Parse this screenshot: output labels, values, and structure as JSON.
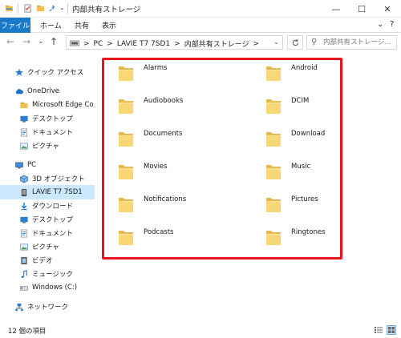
{
  "window": {
    "title": "内部共有ストレージ",
    "minimize": "—",
    "maximize": "☐",
    "close": "✕"
  },
  "ribbon": {
    "tabs": [
      "ファイル",
      "ホーム",
      "共有",
      "表示"
    ],
    "collapse": "⌄",
    "help": "?"
  },
  "nav": {
    "back": "←",
    "forward": "→",
    "recent": "⌄",
    "up": "↑"
  },
  "address": {
    "segments": [
      "PC",
      "LAVIE T7 7SD1",
      "内部共有ストレージ"
    ],
    "separator": ">"
  },
  "search": {
    "placeholder": "内部共有ストレージ..."
  },
  "sidebar": {
    "items": [
      {
        "label": "クイック アクセス",
        "icon": "star-icon"
      },
      {
        "label": "OneDrive",
        "icon": "cloud-icon"
      },
      {
        "label": "Microsoft Edge Co",
        "icon": "folder-icon"
      },
      {
        "label": "デスクトップ",
        "icon": "desktop-icon"
      },
      {
        "label": "ドキュメント",
        "icon": "documents-icon"
      },
      {
        "label": "ピクチャ",
        "icon": "pictures-icon"
      },
      {
        "label": "PC",
        "icon": "pc-icon"
      },
      {
        "label": "3D オブジェクト",
        "icon": "3d-objects-icon"
      },
      {
        "label": "LAVIE T7 7SD1",
        "icon": "device-icon"
      },
      {
        "label": "ダウンロード",
        "icon": "download-icon"
      },
      {
        "label": "デスクトップ",
        "icon": "desktop-icon"
      },
      {
        "label": "ドキュメント",
        "icon": "documents-icon"
      },
      {
        "label": "ピクチャ",
        "icon": "pictures-icon"
      },
      {
        "label": "ビデオ",
        "icon": "video-icon"
      },
      {
        "label": "ミュージック",
        "icon": "music-icon"
      },
      {
        "label": "Windows (C:)",
        "icon": "drive-icon"
      },
      {
        "label": "ネットワーク",
        "icon": "network-icon"
      }
    ]
  },
  "folders": [
    "Alarms",
    "Android",
    "Audiobooks",
    "DCIM",
    "Documents",
    "Download",
    "Movies",
    "Music",
    "Notifications",
    "Pictures",
    "Podcasts",
    "Ringtones"
  ],
  "status": {
    "count": "12 個の項目"
  },
  "colors": {
    "accent": "#1979ca",
    "selection": "#cce8ff",
    "highlight": "#e8141c",
    "folder": "#f8d775"
  }
}
